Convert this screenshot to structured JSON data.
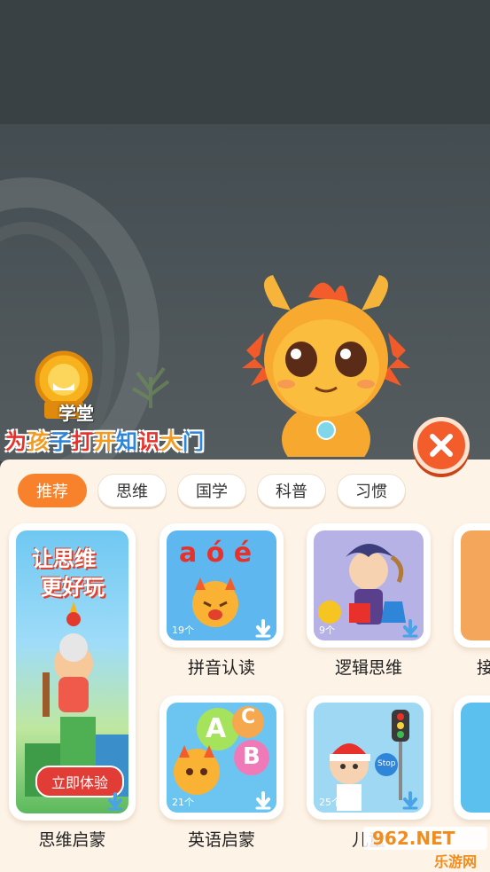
{
  "header": {
    "logo_text": "学堂",
    "slogan": [
      "为",
      "孩",
      "子",
      "打",
      "开",
      "知",
      "识",
      "大",
      "门"
    ],
    "slogan_colors": [
      "#e8312a",
      "#f39a1f",
      "#2f86d8",
      "#e8312a",
      "#f39a1f",
      "#2f86d8",
      "#e8312a",
      "#f39a1f",
      "#2f86d8"
    ]
  },
  "tabs": [
    {
      "label": "推荐",
      "active": true
    },
    {
      "label": "思维",
      "active": false
    },
    {
      "label": "国学",
      "active": false
    },
    {
      "label": "科普",
      "active": false
    },
    {
      "label": "习惯",
      "active": false
    }
  ],
  "featured": {
    "title_line1": "让思维",
    "title_line2": "更好玩",
    "cta": "立即体验",
    "label": "思维启蒙"
  },
  "courses": [
    {
      "label": "拼音认读",
      "count": "19个",
      "art": "a ó é"
    },
    {
      "label": "逻辑思维",
      "count": "9个"
    },
    {
      "label": "接",
      "count": ""
    },
    {
      "label": "英语启蒙",
      "count": "21个",
      "art_letters": [
        "A",
        "C",
        "B"
      ]
    },
    {
      "label": "儿童",
      "count": "25个",
      "sign": "Stop"
    },
    {
      "label": "",
      "count": ""
    }
  ],
  "watermark": {
    "top": "962.NET",
    "bottom": "乐游网"
  },
  "colors": {
    "accent": "#f7822b",
    "panel_bg": "#fdf3e7",
    "close": "#f25d2b",
    "cta": "#e13c36"
  }
}
